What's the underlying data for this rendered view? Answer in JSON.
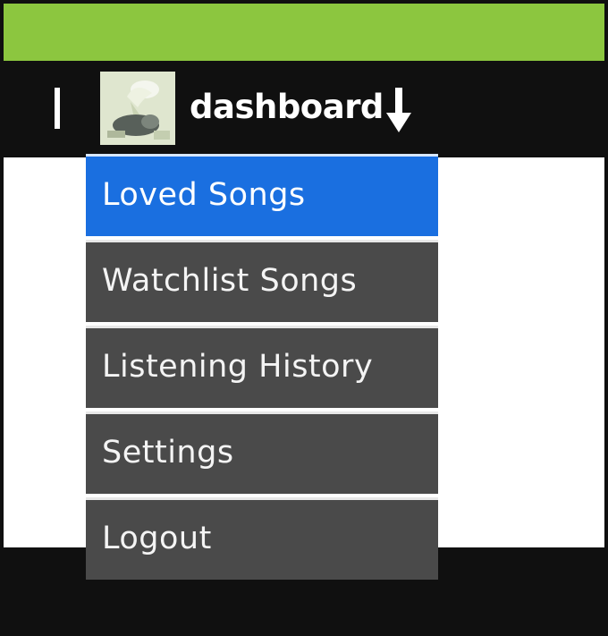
{
  "header": {
    "accent_color": "#8cc63f",
    "background_color": "#101010"
  },
  "user": {
    "name": "dashboard",
    "avatar_icon": "user-avatar-photo",
    "dropdown_icon": "down-arrow-icon"
  },
  "menu": {
    "items": [
      {
        "label": "Loved Songs",
        "active": true
      },
      {
        "label": "Watchlist Songs",
        "active": false
      },
      {
        "label": "Listening History",
        "active": false
      },
      {
        "label": "Settings",
        "active": false
      },
      {
        "label": "Logout",
        "active": false
      }
    ],
    "active_color": "#1a6fe0",
    "item_color": "#4a4a4a"
  }
}
